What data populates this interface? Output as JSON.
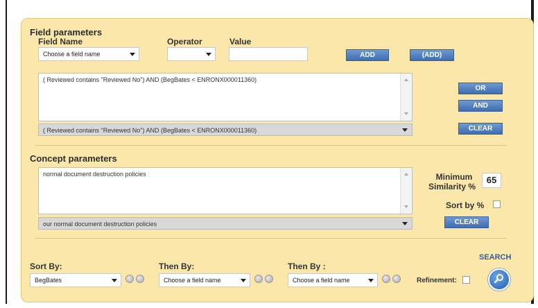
{
  "field_parameters": {
    "title": "Field parameters",
    "field_name_label": "Field Name",
    "operator_label": "Operator",
    "value_label": "Value",
    "field_name_value": "Choose a field name",
    "operator_value": "",
    "value_value": "",
    "add_label": "ADD",
    "add_paren_label": "(ADD)",
    "query_text": "( Reviewed contains \"Reviewed No\") AND  (BegBates < ENRONX000011360)",
    "query_history_value": "( Reviewed contains \"Reviewed No\") AND (BegBates < ENRONX000011360)",
    "or_label": "OR",
    "and_label": "AND",
    "clear_label": "CLEAR"
  },
  "concept_parameters": {
    "title": "Concept parameters",
    "concept_text": "normal document destruction policies",
    "concept_history_value": "our normal document destruction policies",
    "min_similarity_label_1": "Minimum",
    "min_similarity_label_2": "Similarity %",
    "min_similarity_value": "65",
    "sort_by_pct_label": "Sort by %",
    "sort_by_pct_checked": false,
    "clear_label": "CLEAR"
  },
  "sorting": {
    "sort_by_label": "Sort By:",
    "sort_by_value": "BegBates",
    "then_by_1_label": "Then By:",
    "then_by_1_value": "Choose a field name",
    "then_by_2_label": "Then By :",
    "then_by_2_value": "Choose a field name",
    "refinement_label": "Refinement:",
    "refinement_checked": false,
    "search_label": "SEARCH"
  }
}
